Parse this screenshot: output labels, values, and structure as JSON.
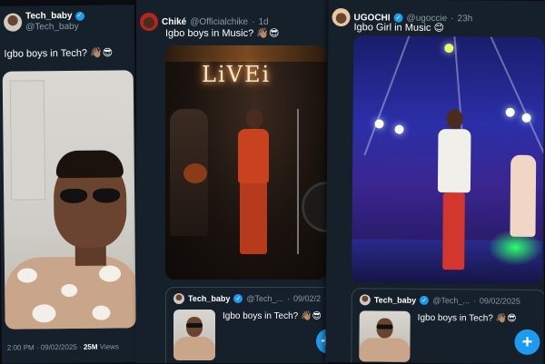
{
  "panels": [
    {
      "author_name": "Tech_baby",
      "author_handle": "@Tech_baby",
      "text": "Igbo boys in Tech? 👋🏽😎",
      "time": "2:00 PM",
      "date": "09/02/2025",
      "views_count": "25M",
      "views_label": "Views"
    },
    {
      "author_name": "Chiké",
      "author_handle": "@Officialchike",
      "age": "1d",
      "text": "Igbo boys in Music? 👋🏽😎",
      "sign_text": "LiVEi",
      "quote": {
        "author_name": "Tech_baby",
        "author_handle": "@Tech_...",
        "date": "09/02/2",
        "text": "Igbo boys in Tech? 👋🏽😎"
      }
    },
    {
      "author_name": "UGOCHI",
      "author_handle": "@ugoccie",
      "age": "23h",
      "text": "Igbo Girl in Music 😊",
      "quote": {
        "author_name": "Tech_baby",
        "author_handle": "@Tech_...",
        "date": "09/02/2025",
        "text": "Igbo boys in Tech? 👋🏽😎"
      }
    }
  ],
  "icons": {
    "verified": "verified-badge-icon",
    "compose": "compose-plus-icon"
  },
  "compose_symbol": "+",
  "colors": {
    "accent": "#1d9bf0",
    "background": "#15202b",
    "muted": "#8b98a5"
  }
}
